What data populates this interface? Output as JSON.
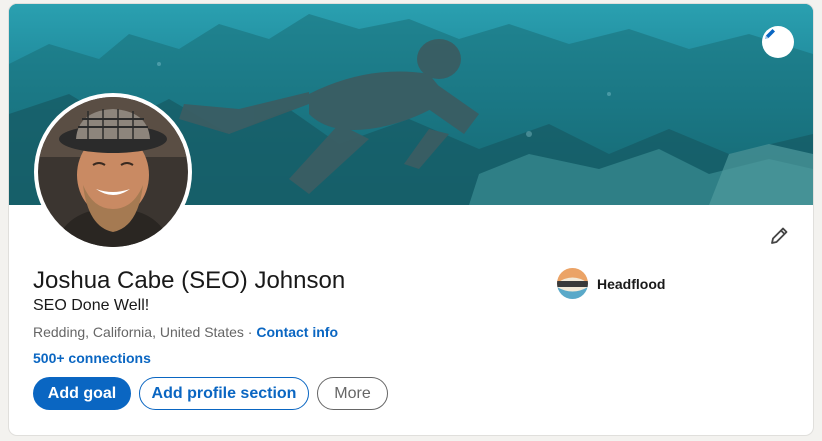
{
  "profile": {
    "name": "Joshua Cabe (SEO) Johnson",
    "headline": "SEO Done Well!",
    "location": "Redding, California, United States",
    "separator": " · ",
    "contact_label": "Contact info",
    "connections": "500+ connections"
  },
  "company": {
    "name": "Headflood",
    "logo_text": "Headflood"
  },
  "actions": {
    "add_goal": "Add goal",
    "add_section": "Add profile section",
    "more": "More"
  },
  "icons": {
    "banner_edit": "pencil-icon",
    "intro_edit": "pencil-icon"
  },
  "colors": {
    "accent": "#0a66c2",
    "text": "#191919",
    "muted": "#666666",
    "page_bg": "#f3f2ef"
  }
}
